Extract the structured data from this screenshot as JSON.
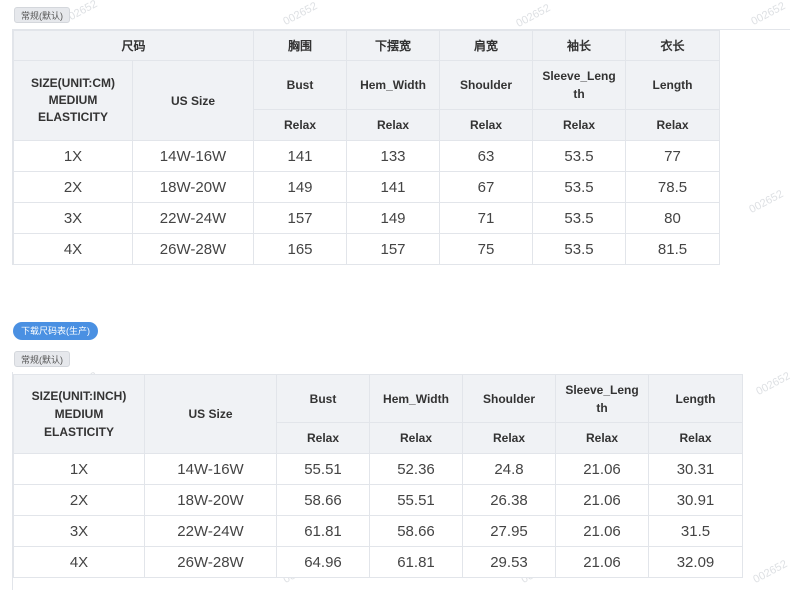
{
  "tag_top": "常规(默认)",
  "button_download": "下载尺码表(生产)",
  "tag_bottom": "常规(默认)",
  "watermark": "002652",
  "table_cm": {
    "cn_headers": [
      "尺码",
      "胸围",
      "下摆宽",
      "肩宽",
      "袖长",
      "衣长"
    ],
    "size_label": "SIZE(UNIT:CM)\nMEDIUM\nELASTICITY",
    "us_size": "US Size",
    "measure_headers": [
      "Bust",
      "Hem_Width",
      "Shoulder",
      "Sleeve_Length",
      "Length"
    ],
    "fit": "Relax",
    "rows": [
      [
        "1X",
        "14W-16W",
        "141",
        "133",
        "63",
        "53.5",
        "77"
      ],
      [
        "2X",
        "18W-20W",
        "149",
        "141",
        "67",
        "53.5",
        "78.5"
      ],
      [
        "3X",
        "22W-24W",
        "157",
        "149",
        "71",
        "53.5",
        "80"
      ],
      [
        "4X",
        "26W-28W",
        "165",
        "157",
        "75",
        "53.5",
        "81.5"
      ]
    ]
  },
  "table_inch": {
    "size_label": "SIZE(UNIT:INCH)\nMEDIUM\nELASTICITY",
    "us_size": "US Size",
    "measure_headers": [
      "Bust",
      "Hem_Width",
      "Shoulder",
      "Sleeve_Length",
      "Length"
    ],
    "fit": "Relax",
    "rows": [
      [
        "1X",
        "14W-16W",
        "55.51",
        "52.36",
        "24.8",
        "21.06",
        "30.31"
      ],
      [
        "2X",
        "18W-20W",
        "58.66",
        "55.51",
        "26.38",
        "21.06",
        "30.91"
      ],
      [
        "3X",
        "22W-24W",
        "61.81",
        "58.66",
        "27.95",
        "21.06",
        "31.5"
      ],
      [
        "4X",
        "26W-28W",
        "64.96",
        "61.81",
        "29.53",
        "21.06",
        "32.09"
      ]
    ]
  }
}
